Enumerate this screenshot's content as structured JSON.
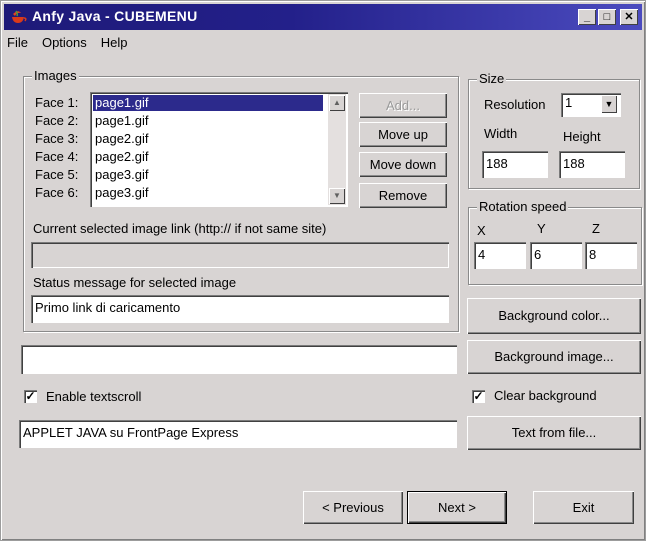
{
  "window": {
    "title": "Anfy Java - CUBEMENU",
    "minimize_glyph": "_",
    "maximize_glyph": "□",
    "close_glyph": "✕"
  },
  "menu": {
    "items": [
      "File",
      "Options",
      "Help"
    ]
  },
  "images": {
    "legend": "Images",
    "face_labels": [
      "Face 1:",
      "Face 2:",
      "Face 3:",
      "Face 4:",
      "Face 5:",
      "Face 6:"
    ],
    "face_values": [
      "page1.gif",
      "page1.gif",
      "page2.gif",
      "page2.gif",
      "page3.gif",
      "page3.gif"
    ],
    "selected_index": 0,
    "add_label": "Add...",
    "move_up_label": "Move up",
    "move_down_label": "Move down",
    "remove_label": "Remove",
    "link_label": "Current selected image link (http:// if not same site)",
    "link_value": "",
    "status_label": "Status message for selected image",
    "status_value": "Primo link di caricamento"
  },
  "textscroll": {
    "extra_field_value": "",
    "enable_label": "Enable textscroll",
    "enable_checked": true,
    "text_value": "APPLET JAVA su FrontPage Express"
  },
  "size": {
    "legend": "Size",
    "resolution_label": "Resolution",
    "resolution_value": "1",
    "width_label": "Width",
    "height_label": "Height",
    "width_value": "188",
    "height_value": "188"
  },
  "rotation": {
    "legend": "Rotation speed",
    "x_label": "X",
    "y_label": "Y",
    "z_label": "Z",
    "x_value": "4",
    "y_value": "6",
    "z_value": "8"
  },
  "background": {
    "color_label": "Background color...",
    "image_label": "Background image...",
    "clear_label": "Clear background",
    "clear_checked": true,
    "text_from_file_label": "Text from file..."
  },
  "nav": {
    "previous_label": "< Previous",
    "next_label": "Next >",
    "exit_label": "Exit"
  },
  "colors": {
    "titlebar_start": "#1e1a78",
    "titlebar_end": "#4b4bbf",
    "selection": "#2c2a8c",
    "face": "#d8d4d3"
  }
}
